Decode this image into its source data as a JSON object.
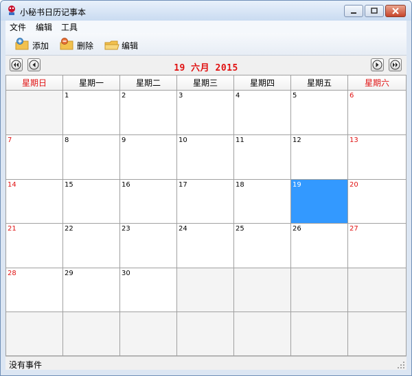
{
  "window": {
    "title": "小秘书日历记事本"
  },
  "menu": [
    {
      "label": "文件"
    },
    {
      "label": "编辑"
    },
    {
      "label": "工具"
    }
  ],
  "toolbar": {
    "add": {
      "label": "添加",
      "icon": "add-folder-icon"
    },
    "delete": {
      "label": "删除",
      "icon": "delete-folder-icon"
    },
    "edit": {
      "label": "编辑",
      "icon": "folder-icon"
    }
  },
  "nav": {
    "title": "19  六月  2015"
  },
  "weekdays": [
    "星期日",
    "星期一",
    "星期二",
    "星期三",
    "星期四",
    "星期五",
    "星期六"
  ],
  "weeks": [
    [
      "",
      "1",
      "2",
      "3",
      "4",
      "5",
      "6"
    ],
    [
      "7",
      "8",
      "9",
      "10",
      "11",
      "12",
      "13"
    ],
    [
      "14",
      "15",
      "16",
      "17",
      "18",
      "19",
      "20"
    ],
    [
      "21",
      "22",
      "23",
      "24",
      "25",
      "26",
      "27"
    ],
    [
      "28",
      "29",
      "30",
      "",
      "",
      "",
      ""
    ],
    [
      "",
      "",
      "",
      "",
      "",
      "",
      ""
    ]
  ],
  "selected_day": "19",
  "status": {
    "text": "没有事件"
  },
  "colors": {
    "weekend": "#e01010",
    "selected": "#3399ff",
    "title_red": "#e01010"
  }
}
